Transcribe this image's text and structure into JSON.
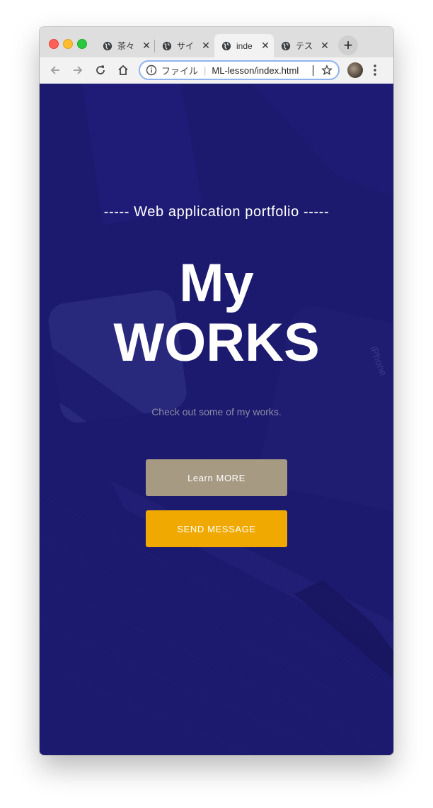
{
  "browser": {
    "tabs": [
      {
        "label": "茶々",
        "active": false
      },
      {
        "label": "サイ",
        "active": false
      },
      {
        "label": "inde",
        "active": true
      },
      {
        "label": "テス",
        "active": false
      }
    ],
    "close_glyph": "✕",
    "new_tab_glyph": "+",
    "omnibox": {
      "scheme_label": "ファイル",
      "separator": "|",
      "url": "ML-lesson/index.html"
    }
  },
  "page": {
    "subtitle": "----- Web application portfolio -----",
    "hero_line1": "My",
    "hero_line2": "WORKS",
    "tagline": "Check out some of my works.",
    "learn_button": "Learn MORE",
    "send_button": "SEND MESSAGE",
    "device_text": "iPhone"
  },
  "colors": {
    "background": "#1b1a6e",
    "learn_button": "#a69a83",
    "send_button": "#f0a900",
    "tagline": "#8d8ba4"
  },
  "icons": {
    "back": "back-arrow-icon",
    "forward": "forward-arrow-icon",
    "reload": "reload-icon",
    "home": "home-icon",
    "info": "info-icon",
    "bookmark": "star-icon",
    "menu": "kebab-menu-icon",
    "tab": "globe-icon"
  }
}
